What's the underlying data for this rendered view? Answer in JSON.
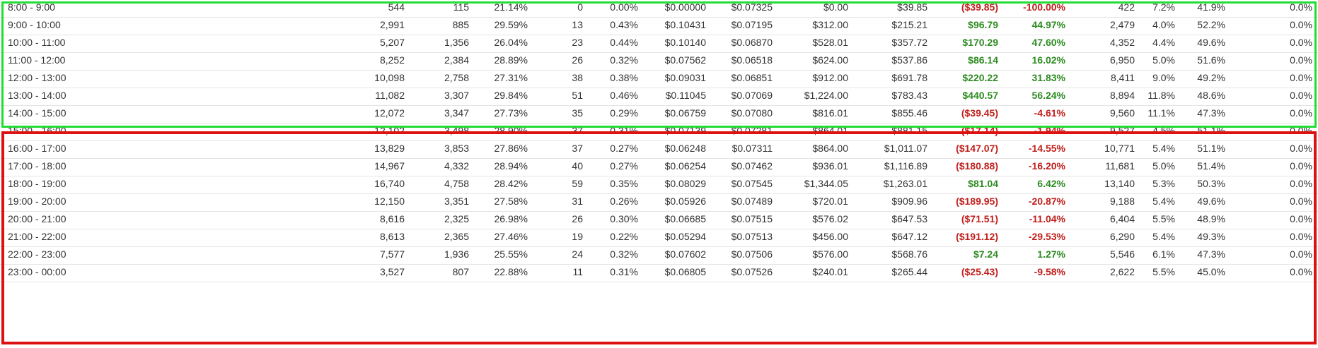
{
  "colors": {
    "positive": "#2e8b22",
    "negative": "#c0201d",
    "highlight_green": "#22dd33",
    "highlight_red": "#dd1111"
  },
  "rows": [
    {
      "time": "8:00 - 9:00",
      "cells": [
        "544",
        "115",
        "21.14%",
        "0",
        "0.00%",
        "$0.00000",
        "$0.07325",
        "$0.00",
        "$39.85",
        "($39.85)",
        "-100.00%",
        "422",
        "7.2%",
        "41.9%",
        "0.0%"
      ],
      "trend": "neg"
    },
    {
      "time": "9:00 - 10:00",
      "cells": [
        "2,991",
        "885",
        "29.59%",
        "13",
        "0.43%",
        "$0.10431",
        "$0.07195",
        "$312.00",
        "$215.21",
        "$96.79",
        "44.97%",
        "2,479",
        "4.0%",
        "52.2%",
        "0.0%"
      ],
      "trend": "pos"
    },
    {
      "time": "10:00 - 11:00",
      "cells": [
        "5,207",
        "1,356",
        "26.04%",
        "23",
        "0.44%",
        "$0.10140",
        "$0.06870",
        "$528.01",
        "$357.72",
        "$170.29",
        "47.60%",
        "4,352",
        "4.4%",
        "49.6%",
        "0.0%"
      ],
      "trend": "pos"
    },
    {
      "time": "11:00 - 12:00",
      "cells": [
        "8,252",
        "2,384",
        "28.89%",
        "26",
        "0.32%",
        "$0.07562",
        "$0.06518",
        "$624.00",
        "$537.86",
        "$86.14",
        "16.02%",
        "6,950",
        "5.0%",
        "51.6%",
        "0.0%"
      ],
      "trend": "pos"
    },
    {
      "time": "12:00 - 13:00",
      "cells": [
        "10,098",
        "2,758",
        "27.31%",
        "38",
        "0.38%",
        "$0.09031",
        "$0.06851",
        "$912.00",
        "$691.78",
        "$220.22",
        "31.83%",
        "8,411",
        "9.0%",
        "49.2%",
        "0.0%"
      ],
      "trend": "pos"
    },
    {
      "time": "13:00 - 14:00",
      "cells": [
        "11,082",
        "3,307",
        "29.84%",
        "51",
        "0.46%",
        "$0.11045",
        "$0.07069",
        "$1,224.00",
        "$783.43",
        "$440.57",
        "56.24%",
        "8,894",
        "11.8%",
        "48.6%",
        "0.0%"
      ],
      "trend": "pos"
    },
    {
      "time": "14:00 - 15:00",
      "cells": [
        "12,072",
        "3,347",
        "27.73%",
        "35",
        "0.29%",
        "$0.06759",
        "$0.07080",
        "$816.01",
        "$855.46",
        "($39.45)",
        "-4.61%",
        "9,560",
        "11.1%",
        "47.3%",
        "0.0%"
      ],
      "trend": "neg"
    },
    {
      "time": "15:00 - 16:00",
      "cells": [
        "12,102",
        "3,498",
        "28.90%",
        "37",
        "0.31%",
        "$0.07139",
        "$0.07281",
        "$864.01",
        "$881.15",
        "($17.14)",
        "-1.94%",
        "9,527",
        "4.5%",
        "51.1%",
        "0.0%"
      ],
      "trend": "neg"
    },
    {
      "time": "16:00 - 17:00",
      "cells": [
        "13,829",
        "3,853",
        "27.86%",
        "37",
        "0.27%",
        "$0.06248",
        "$0.07311",
        "$864.00",
        "$1,011.07",
        "($147.07)",
        "-14.55%",
        "10,771",
        "5.4%",
        "51.1%",
        "0.0%"
      ],
      "trend": "neg"
    },
    {
      "time": "17:00 - 18:00",
      "cells": [
        "14,967",
        "4,332",
        "28.94%",
        "40",
        "0.27%",
        "$0.06254",
        "$0.07462",
        "$936.01",
        "$1,116.89",
        "($180.88)",
        "-16.20%",
        "11,681",
        "5.0%",
        "51.4%",
        "0.0%"
      ],
      "trend": "neg"
    },
    {
      "time": "18:00 - 19:00",
      "cells": [
        "16,740",
        "4,758",
        "28.42%",
        "59",
        "0.35%",
        "$0.08029",
        "$0.07545",
        "$1,344.05",
        "$1,263.01",
        "$81.04",
        "6.42%",
        "13,140",
        "5.3%",
        "50.3%",
        "0.0%"
      ],
      "trend": "pos"
    },
    {
      "time": "19:00 - 20:00",
      "cells": [
        "12,150",
        "3,351",
        "27.58%",
        "31",
        "0.26%",
        "$0.05926",
        "$0.07489",
        "$720.01",
        "$909.96",
        "($189.95)",
        "-20.87%",
        "9,188",
        "5.4%",
        "49.6%",
        "0.0%"
      ],
      "trend": "neg"
    },
    {
      "time": "20:00 - 21:00",
      "cells": [
        "8,616",
        "2,325",
        "26.98%",
        "26",
        "0.30%",
        "$0.06685",
        "$0.07515",
        "$576.02",
        "$647.53",
        "($71.51)",
        "-11.04%",
        "6,404",
        "5.5%",
        "48.9%",
        "0.0%"
      ],
      "trend": "neg"
    },
    {
      "time": "21:00 - 22:00",
      "cells": [
        "8,613",
        "2,365",
        "27.46%",
        "19",
        "0.22%",
        "$0.05294",
        "$0.07513",
        "$456.00",
        "$647.12",
        "($191.12)",
        "-29.53%",
        "6,290",
        "5.4%",
        "49.3%",
        "0.0%"
      ],
      "trend": "neg"
    },
    {
      "time": "22:00 - 23:00",
      "cells": [
        "7,577",
        "1,936",
        "25.55%",
        "24",
        "0.32%",
        "$0.07602",
        "$0.07506",
        "$576.00",
        "$568.76",
        "$7.24",
        "1.27%",
        "5,546",
        "6.1%",
        "47.3%",
        "0.0%"
      ],
      "trend": "pos"
    },
    {
      "time": "23:00 - 00:00",
      "cells": [
        "3,527",
        "807",
        "22.88%",
        "11",
        "0.31%",
        "$0.06805",
        "$0.07526",
        "$240.01",
        "$265.44",
        "($25.43)",
        "-9.58%",
        "2,622",
        "5.5%",
        "45.0%",
        "0.0%"
      ],
      "trend": "neg"
    }
  ]
}
